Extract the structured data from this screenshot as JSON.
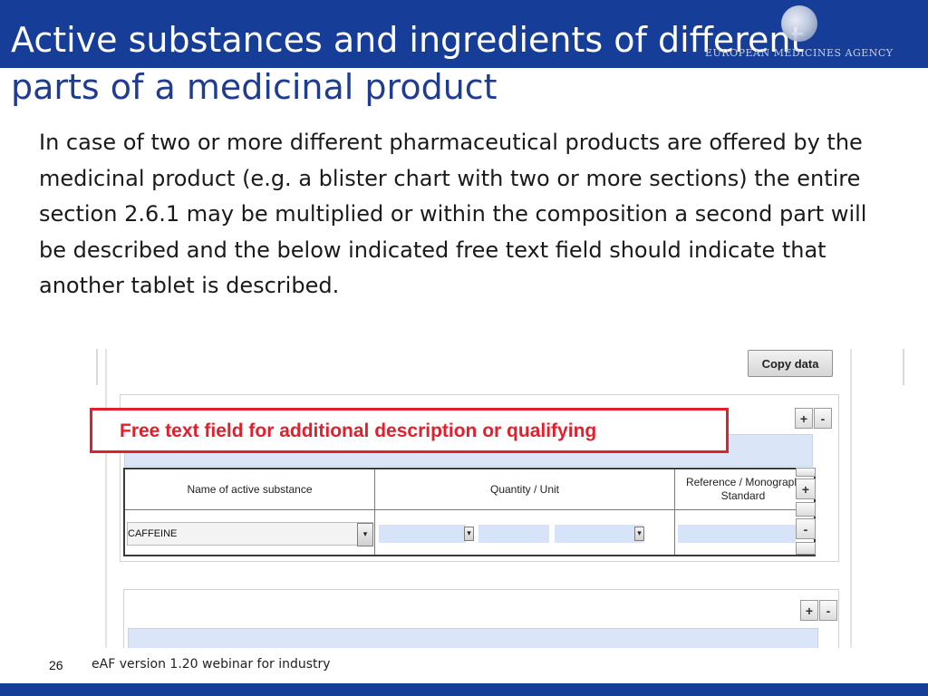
{
  "header": {
    "title_line_1": "Active substances and ingredients of different",
    "title_line_2": "parts of a medicinal product",
    "logo_text": "EUROPEAN MEDICINES AGENCY"
  },
  "body": {
    "paragraph": "In case of two or more different pharmaceutical products are offered by the medicinal product (e.g. a blister chart with two or more sections) the entire section 2.6.1 may be multiplied or within the composition a second part will be described and the below indicated free text field should indicate that another tablet is described."
  },
  "form": {
    "copy_button_label": "Copy data",
    "add_label": "+",
    "remove_label": "-",
    "dropdown_arrow": "▾",
    "table": {
      "headers": [
        "Name of active substance",
        "Quantity / Unit",
        "Reference / Monograph Standard"
      ],
      "substance_value": "CAFFEINE"
    }
  },
  "callout": {
    "text": "Free text field for additional description or qualifying"
  },
  "footer": {
    "page_number": "26",
    "text": "eAF version 1.20 webinar for industry"
  },
  "colors": {
    "brand_blue": "#163d98",
    "title_blue": "#1f3c90",
    "callout_red": "#e0202d",
    "field_blue": "#dbe5f8"
  }
}
